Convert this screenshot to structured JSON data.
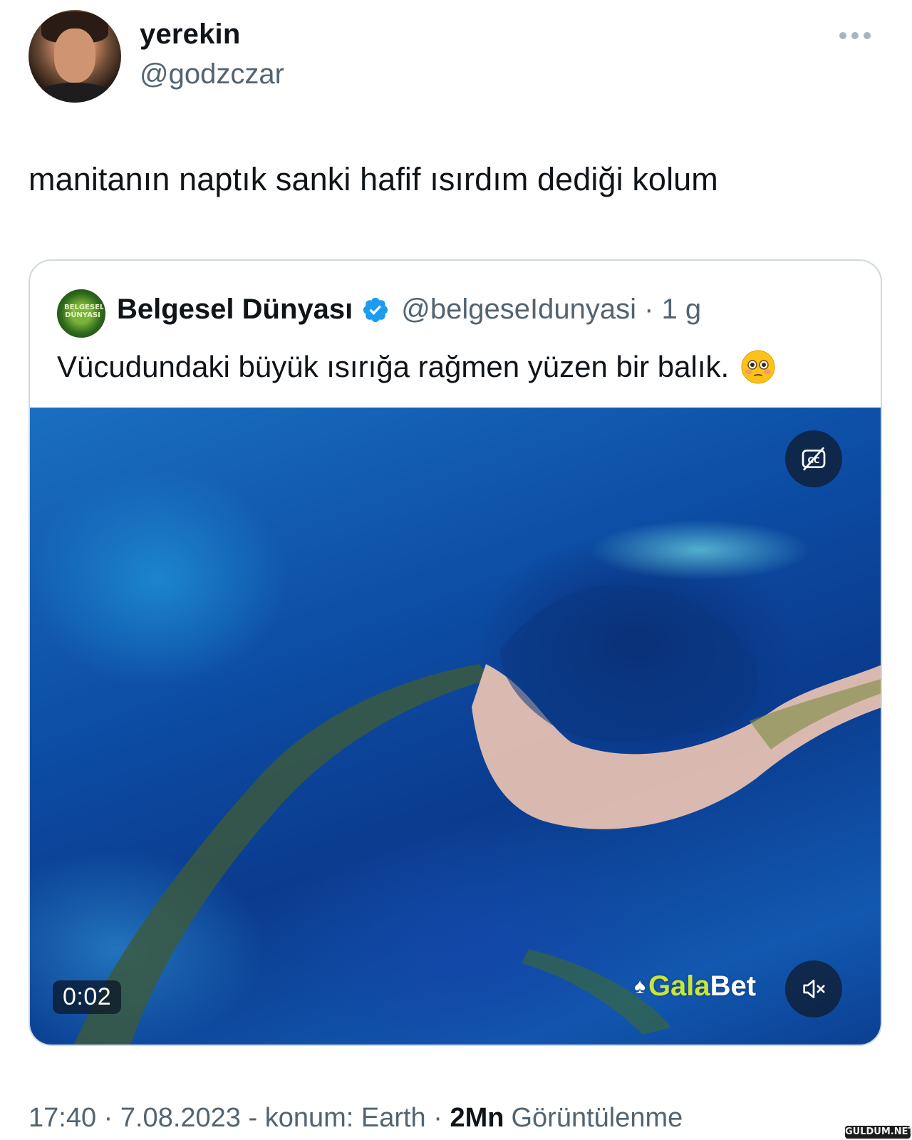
{
  "tweet": {
    "display_name": "yerekin",
    "handle": "@godzczar",
    "text": "manitanın naptık sanki hafif ısırdım dediği kolum",
    "more_icon": "more-horizontal-icon",
    "meta": {
      "time_date": "17:40 · 7.08.2023",
      "location": " - konum: Earth · ",
      "views_count": "2Mn",
      "views_label": "Görüntülenme"
    }
  },
  "quote": {
    "avatar_text": "BELGESEL DÜNYASI",
    "name": "Belgesel Dünyası",
    "handle_time": "@belgeseIdunyasi · 1 g",
    "text": "Vücudundaki büyük ısırığa rağmen yüzen bir balık.",
    "emoji_icon": "flushed-face-icon",
    "verified_color": "#1d9bf0",
    "video": {
      "duration": "0:02",
      "watermark_prefix": "Gala",
      "watermark_suffix": "Bet",
      "accent_color": "#c6e53d",
      "captions_icon": "captions-off-icon",
      "mute_icon": "speaker-muted-icon"
    }
  },
  "site_watermark": "GULDUM.NET"
}
